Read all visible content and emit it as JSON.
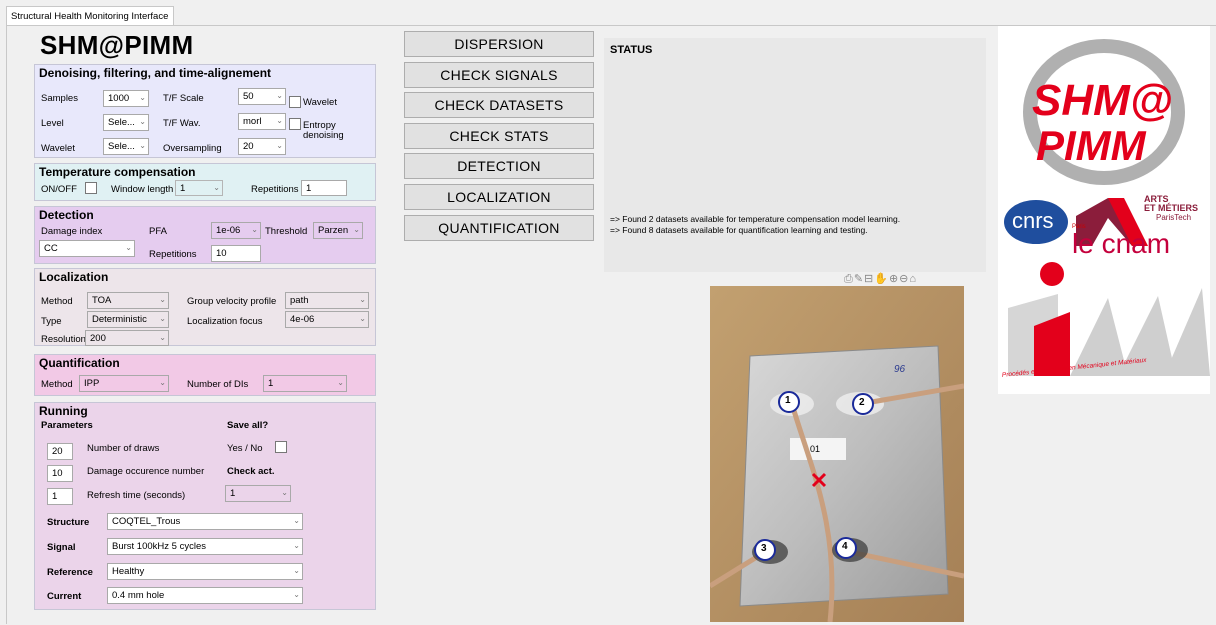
{
  "window": {
    "tab_title": "Structural Health Monitoring Interface"
  },
  "app_title": "SHM@PIMM",
  "denoising": {
    "title": "Denoising, filtering, and time-alignement",
    "samples_label": "Samples",
    "samples_value": "1000",
    "level_label": "Level",
    "level_value": "Sele...",
    "wavelet_label": "Wavelet",
    "wavelet_value": "Sele...",
    "tf_scale_label": "T/F Scale",
    "tf_scale_value": "50",
    "tf_wav_label": "T/F Wav.",
    "tf_wav_value": "morl",
    "oversampling_label": "Oversampling",
    "oversampling_value": "20",
    "wavelet_check_label": "Wavelet",
    "entropy_label_1": "Entropy",
    "entropy_label_2": "denoising"
  },
  "temperature": {
    "title": "Temperature compensation",
    "onoff_label": "ON/OFF",
    "window_length_label": "Window length",
    "window_length_value": "1",
    "repetitions_label": "Repetitions",
    "repetitions_value": "1"
  },
  "detection": {
    "title": "Detection",
    "damage_index_label": "Damage index",
    "damage_index_value": "CC",
    "pfa_label": "PFA",
    "pfa_value": "1e-06",
    "threshold_label": "Threshold",
    "threshold_value": "Parzen",
    "repetitions_label": "Repetitions",
    "repetitions_value": "10"
  },
  "localization": {
    "title": "Localization",
    "method_label": "Method",
    "method_value": "TOA",
    "type_label": "Type",
    "type_value": "Deterministic",
    "resolution_label": "Resolution",
    "resolution_value": "200",
    "group_velocity_label": "Group velocity profile",
    "group_velocity_value": "path",
    "focus_label": "Localization focus",
    "focus_value": "4e-06"
  },
  "quantification": {
    "title": "Quantification",
    "method_label": "Method",
    "method_value": "IPP",
    "num_dis_label": "Number of DIs",
    "num_dis_value": "1"
  },
  "running": {
    "title": "Running",
    "parameters_label": "Parameters",
    "draws_value": "20",
    "draws_label": "Number of draws",
    "damage_occ_value": "10",
    "damage_occ_label": "Damage occurence number",
    "refresh_value": "1",
    "refresh_label": "Refresh time (seconds)",
    "save_all_label": "Save all?",
    "yes_no_label": "Yes / No",
    "check_act_label": "Check act.",
    "check_act_value": "1",
    "structure_label": "Structure",
    "structure_value": "COQTEL_Trous",
    "signal_label": "Signal",
    "signal_value": "Burst 100kHz 5 cycles",
    "reference_label": "Reference",
    "reference_value": "Healthy",
    "current_label": "Current",
    "current_value": "0.4 mm hole"
  },
  "buttons": [
    "DISPERSION",
    "CHECK SIGNALS",
    "CHECK DATASETS",
    "CHECK STATS",
    "DETECTION",
    "LOCALIZATION",
    "QUANTIFICATION"
  ],
  "status": {
    "title": "STATUS",
    "line1": "=> Found 2 datasets available for temperature compensation model learning.",
    "line2": "=> Found 8 datasets available for quantification learning and testing."
  },
  "plate": {
    "label": "01",
    "handwriting": "96",
    "sensors": [
      "1",
      "2",
      "3",
      "4"
    ]
  },
  "logos": {
    "shm_line1": "SHM@",
    "shm_line2": "PIMM",
    "cnrs": "cnrs",
    "arts_1": "ARTS",
    "arts_2": "ET MÉTIERS",
    "arts_3": "ParisTech",
    "cnam": "le cnam",
    "cnam_paris": "Paris",
    "pimm_tagline": "Procédés et Ingénierie en Mécanique et Matériaux"
  },
  "colors": {
    "denoising_bg": "#e8e8fb",
    "temperature_bg": "#e0f1f3",
    "detection_bg": "#e5ccef",
    "localization_bg": "#ede5ea",
    "quantification_bg": "#f2c9e6",
    "running_bg": "#ebd4ea",
    "logo_red": "#e3001b",
    "cnrs_blue": "#1f4e9e"
  }
}
